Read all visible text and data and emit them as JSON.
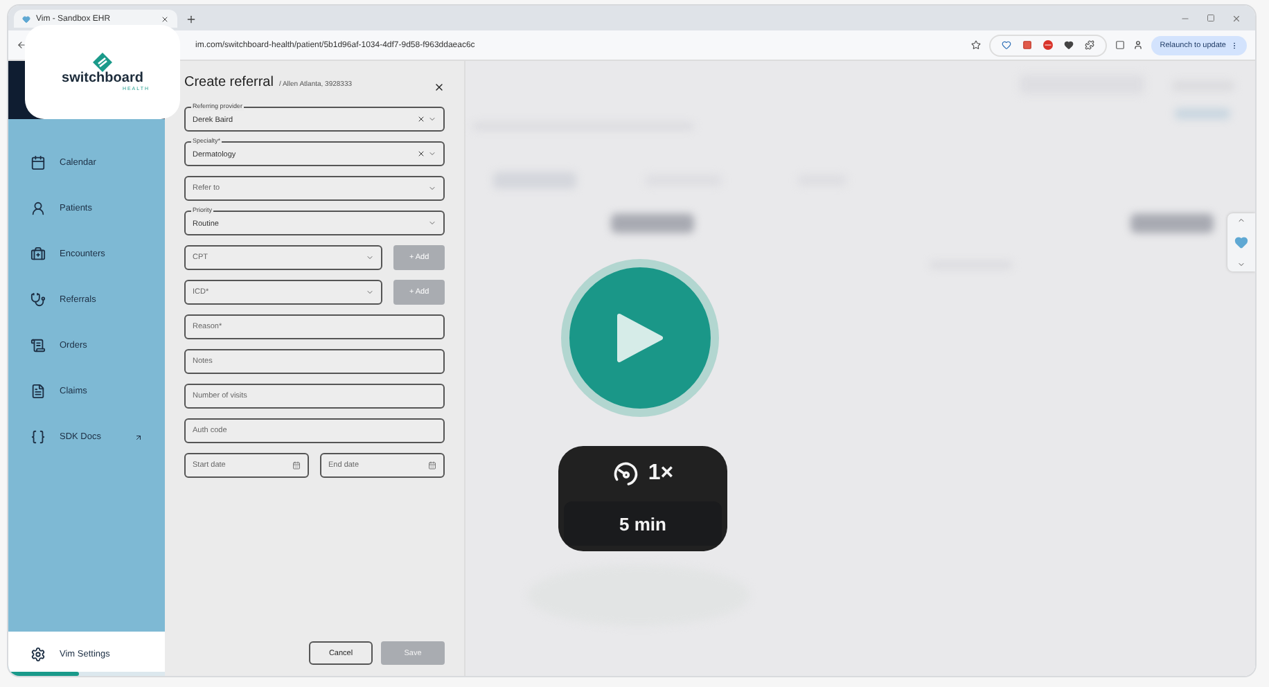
{
  "browser": {
    "tab_title": "Vim - Sandbox EHR",
    "url": "im.com/switchboard-health/patient/5b1d96af-1034-4df7-9d58-f963ddaeac6c",
    "relaunch": "Relaunch to update"
  },
  "logo": {
    "name": "switchboard",
    "tagline": "HEALTH"
  },
  "sidebar": {
    "items": [
      {
        "label": "Calendar",
        "external": false
      },
      {
        "label": "Patients",
        "external": false
      },
      {
        "label": "Encounters",
        "external": false
      },
      {
        "label": "Referrals",
        "external": false
      },
      {
        "label": "Orders",
        "external": false
      },
      {
        "label": "Claims",
        "external": false
      },
      {
        "label": "SDK Docs",
        "external": true
      }
    ],
    "settings": "Vim Settings",
    "progress": {
      "level": 0.45
    }
  },
  "form": {
    "title": "Create referral",
    "subtitle": "/ Allen Atlanta, 3928333",
    "fields": [
      {
        "kind": "select",
        "label": "Referring provider",
        "value": "Derek Baird",
        "clearable": true
      },
      {
        "kind": "select",
        "label": "Specialty*",
        "value": "Dermatology",
        "clearable": true
      },
      {
        "kind": "select",
        "placeholder": "Refer to",
        "clearable": false
      },
      {
        "kind": "select",
        "label": "Priority",
        "value": "Routine",
        "clearable": false
      },
      {
        "kind": "code",
        "placeholder": "CPT",
        "button": "+ Add"
      },
      {
        "kind": "code",
        "placeholder": "ICD*",
        "button": "+ Add"
      },
      {
        "kind": "text",
        "placeholder": "Reason*"
      },
      {
        "kind": "text",
        "placeholder": "Notes"
      },
      {
        "kind": "text",
        "placeholder": "Number of visits"
      },
      {
        "kind": "text",
        "placeholder": "Auth code"
      },
      {
        "kind": "dates",
        "placeholders": [
          "Start date",
          "End date"
        ]
      }
    ],
    "cancel": "Cancel",
    "save": "Save",
    "save_disabled": true
  },
  "video": {
    "speed": "1×",
    "duration": "5 min"
  }
}
